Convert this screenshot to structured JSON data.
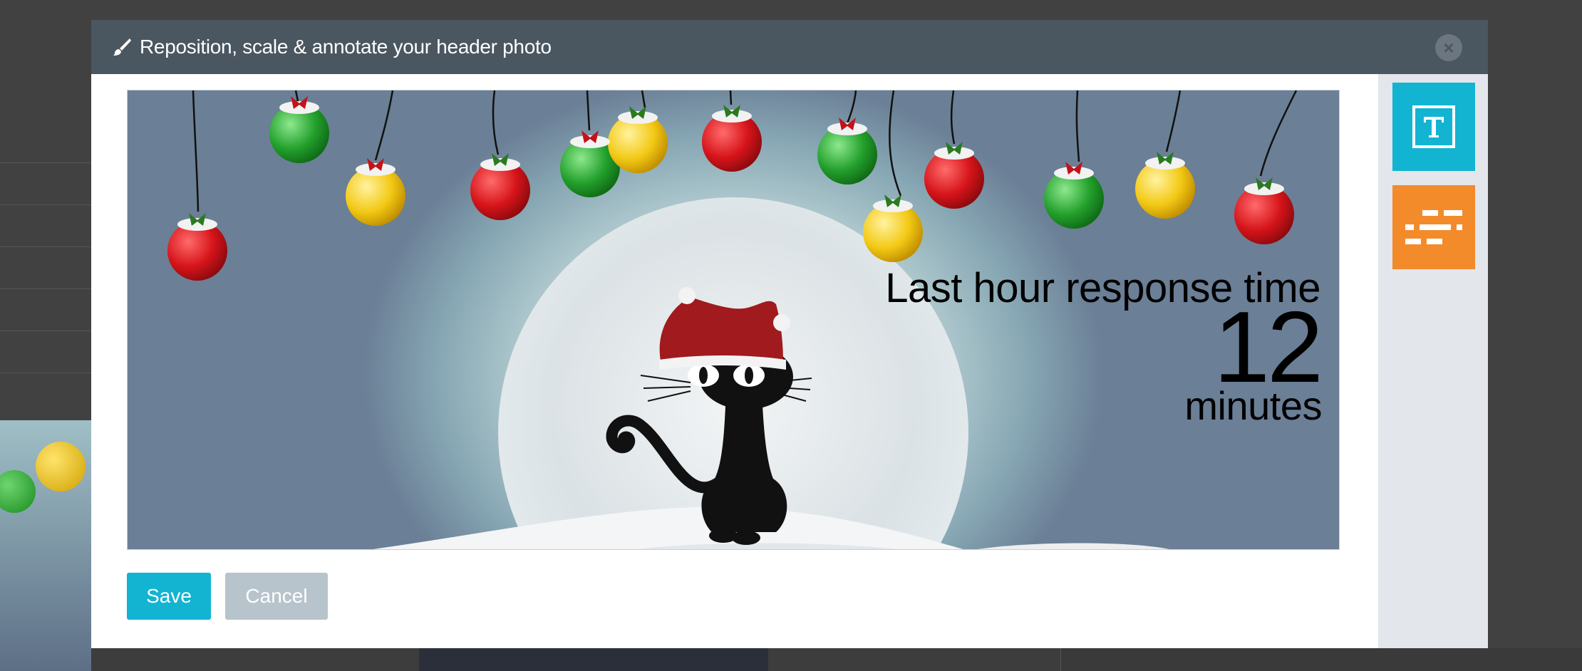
{
  "modal": {
    "title": "Reposition, scale & annotate your header photo",
    "close_symbol": "×"
  },
  "overlay": {
    "title": "Last hour response time",
    "value": "12",
    "unit": "minutes"
  },
  "actions": {
    "save_label": "Save",
    "cancel_label": "Cancel"
  },
  "sidebar": {
    "tools": [
      {
        "icon": "text-tool-icon",
        "color": "#12b4d2"
      },
      {
        "icon": "lines-tool-icon",
        "color": "#f38b2b"
      }
    ]
  },
  "colors": {
    "accent": "#12b4d2",
    "header": "#4a5660",
    "orange": "#f38b2b",
    "cancel": "#b8c4cc"
  }
}
